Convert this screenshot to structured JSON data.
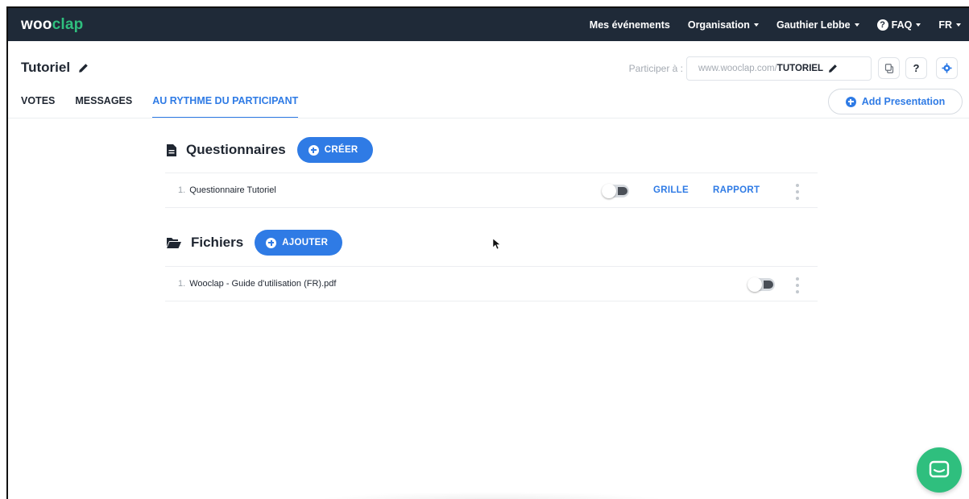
{
  "app": {
    "logo_part1": "woo",
    "logo_part2": "clap",
    "brand_color": "#2fbf7e",
    "accent_color": "#2f7be5",
    "nav_bg_color": "#1f2a38"
  },
  "nav": {
    "events": "Mes événements",
    "organisation": "Organisation",
    "user": "Gauthier Lebbe",
    "faq": "FAQ",
    "language": "FR"
  },
  "event": {
    "title": "Tutoriel",
    "participate_label": "Participer à :",
    "url_prefix": "www.wooclap.com/",
    "url_code": "TUTORIEL",
    "copy_icon": "copy-icon",
    "help_label": "?",
    "settings_icon": "gear-icon"
  },
  "tabs": [
    {
      "label": "VOTES",
      "active": false
    },
    {
      "label": "MESSAGES",
      "active": false
    },
    {
      "label": "AU RYTHME DU PARTICIPANT",
      "active": true
    }
  ],
  "add_presentation": "Add Presentation",
  "questionnaires": {
    "title": "Questionnaires",
    "button": "CRÉER",
    "items": [
      {
        "num": "1.",
        "label": "Questionnaire Tutoriel",
        "link1": "GRILLE",
        "link2": "RAPPORT"
      }
    ]
  },
  "fichiers": {
    "title": "Fichiers",
    "button": "AJOUTER",
    "items": [
      {
        "num": "1.",
        "label": "Wooclap - Guide d'utilisation (FR).pdf"
      }
    ]
  }
}
